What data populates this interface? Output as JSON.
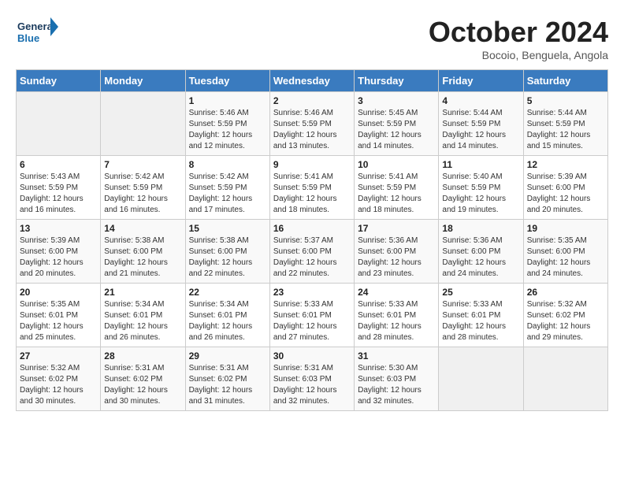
{
  "logo": {
    "general": "General",
    "blue": "Blue"
  },
  "header": {
    "month": "October 2024",
    "location": "Bocoio, Benguela, Angola"
  },
  "days_of_week": [
    "Sunday",
    "Monday",
    "Tuesday",
    "Wednesday",
    "Thursday",
    "Friday",
    "Saturday"
  ],
  "weeks": [
    [
      {
        "day": "",
        "info": ""
      },
      {
        "day": "",
        "info": ""
      },
      {
        "day": "1",
        "info": "Sunrise: 5:46 AM\nSunset: 5:59 PM\nDaylight: 12 hours and 12 minutes."
      },
      {
        "day": "2",
        "info": "Sunrise: 5:46 AM\nSunset: 5:59 PM\nDaylight: 12 hours and 13 minutes."
      },
      {
        "day": "3",
        "info": "Sunrise: 5:45 AM\nSunset: 5:59 PM\nDaylight: 12 hours and 14 minutes."
      },
      {
        "day": "4",
        "info": "Sunrise: 5:44 AM\nSunset: 5:59 PM\nDaylight: 12 hours and 14 minutes."
      },
      {
        "day": "5",
        "info": "Sunrise: 5:44 AM\nSunset: 5:59 PM\nDaylight: 12 hours and 15 minutes."
      }
    ],
    [
      {
        "day": "6",
        "info": "Sunrise: 5:43 AM\nSunset: 5:59 PM\nDaylight: 12 hours and 16 minutes."
      },
      {
        "day": "7",
        "info": "Sunrise: 5:42 AM\nSunset: 5:59 PM\nDaylight: 12 hours and 16 minutes."
      },
      {
        "day": "8",
        "info": "Sunrise: 5:42 AM\nSunset: 5:59 PM\nDaylight: 12 hours and 17 minutes."
      },
      {
        "day": "9",
        "info": "Sunrise: 5:41 AM\nSunset: 5:59 PM\nDaylight: 12 hours and 18 minutes."
      },
      {
        "day": "10",
        "info": "Sunrise: 5:41 AM\nSunset: 5:59 PM\nDaylight: 12 hours and 18 minutes."
      },
      {
        "day": "11",
        "info": "Sunrise: 5:40 AM\nSunset: 5:59 PM\nDaylight: 12 hours and 19 minutes."
      },
      {
        "day": "12",
        "info": "Sunrise: 5:39 AM\nSunset: 6:00 PM\nDaylight: 12 hours and 20 minutes."
      }
    ],
    [
      {
        "day": "13",
        "info": "Sunrise: 5:39 AM\nSunset: 6:00 PM\nDaylight: 12 hours and 20 minutes."
      },
      {
        "day": "14",
        "info": "Sunrise: 5:38 AM\nSunset: 6:00 PM\nDaylight: 12 hours and 21 minutes."
      },
      {
        "day": "15",
        "info": "Sunrise: 5:38 AM\nSunset: 6:00 PM\nDaylight: 12 hours and 22 minutes."
      },
      {
        "day": "16",
        "info": "Sunrise: 5:37 AM\nSunset: 6:00 PM\nDaylight: 12 hours and 22 minutes."
      },
      {
        "day": "17",
        "info": "Sunrise: 5:36 AM\nSunset: 6:00 PM\nDaylight: 12 hours and 23 minutes."
      },
      {
        "day": "18",
        "info": "Sunrise: 5:36 AM\nSunset: 6:00 PM\nDaylight: 12 hours and 24 minutes."
      },
      {
        "day": "19",
        "info": "Sunrise: 5:35 AM\nSunset: 6:00 PM\nDaylight: 12 hours and 24 minutes."
      }
    ],
    [
      {
        "day": "20",
        "info": "Sunrise: 5:35 AM\nSunset: 6:01 PM\nDaylight: 12 hours and 25 minutes."
      },
      {
        "day": "21",
        "info": "Sunrise: 5:34 AM\nSunset: 6:01 PM\nDaylight: 12 hours and 26 minutes."
      },
      {
        "day": "22",
        "info": "Sunrise: 5:34 AM\nSunset: 6:01 PM\nDaylight: 12 hours and 26 minutes."
      },
      {
        "day": "23",
        "info": "Sunrise: 5:33 AM\nSunset: 6:01 PM\nDaylight: 12 hours and 27 minutes."
      },
      {
        "day": "24",
        "info": "Sunrise: 5:33 AM\nSunset: 6:01 PM\nDaylight: 12 hours and 28 minutes."
      },
      {
        "day": "25",
        "info": "Sunrise: 5:33 AM\nSunset: 6:01 PM\nDaylight: 12 hours and 28 minutes."
      },
      {
        "day": "26",
        "info": "Sunrise: 5:32 AM\nSunset: 6:02 PM\nDaylight: 12 hours and 29 minutes."
      }
    ],
    [
      {
        "day": "27",
        "info": "Sunrise: 5:32 AM\nSunset: 6:02 PM\nDaylight: 12 hours and 30 minutes."
      },
      {
        "day": "28",
        "info": "Sunrise: 5:31 AM\nSunset: 6:02 PM\nDaylight: 12 hours and 30 minutes."
      },
      {
        "day": "29",
        "info": "Sunrise: 5:31 AM\nSunset: 6:02 PM\nDaylight: 12 hours and 31 minutes."
      },
      {
        "day": "30",
        "info": "Sunrise: 5:31 AM\nSunset: 6:03 PM\nDaylight: 12 hours and 32 minutes."
      },
      {
        "day": "31",
        "info": "Sunrise: 5:30 AM\nSunset: 6:03 PM\nDaylight: 12 hours and 32 minutes."
      },
      {
        "day": "",
        "info": ""
      },
      {
        "day": "",
        "info": ""
      }
    ]
  ]
}
